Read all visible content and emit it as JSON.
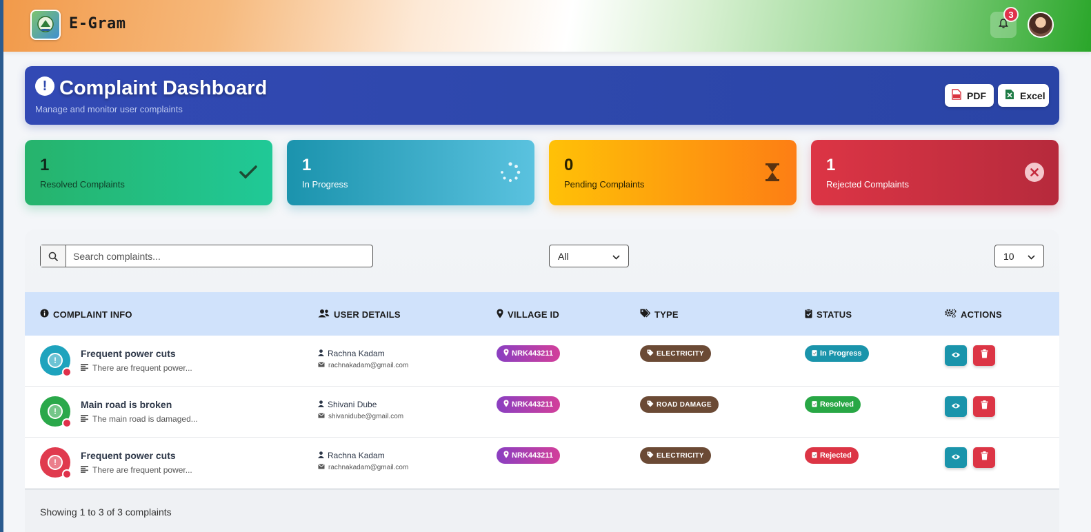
{
  "header": {
    "brand": "E-Gram",
    "notification_count": "3"
  },
  "hero": {
    "title": "Complaint Dashboard",
    "subtitle": "Manage and monitor user complaints",
    "pdf_label": "PDF",
    "excel_label": "Excel"
  },
  "stats": [
    {
      "value": "1",
      "label": "Resolved Complaints",
      "icon": "check-icon"
    },
    {
      "value": "1",
      "label": "In Progress",
      "icon": "spinner-icon"
    },
    {
      "value": "0",
      "label": "Pending Complaints",
      "icon": "hourglass-icon"
    },
    {
      "value": "1",
      "label": "Rejected Complaints",
      "icon": "x-circle-icon"
    }
  ],
  "controls": {
    "search_placeholder": "Search complaints...",
    "filter_value": "All",
    "per_page_value": "10"
  },
  "table": {
    "columns": [
      "COMPLAINT INFO",
      "USER DETAILS",
      "VILLAGE ID",
      "TYPE",
      "STATUS",
      "ACTIONS"
    ],
    "rows": [
      {
        "title": "Frequent power cuts",
        "desc": "There are frequent power...",
        "name": "Rachna Kadam",
        "email": "rachnakadam@gmail.com",
        "village": "NRK443211",
        "type": "ELECTRICITY",
        "status": "In Progress",
        "status_color": "#1a94ab",
        "icon_color": "#1ea3bd"
      },
      {
        "title": "Main road is broken",
        "desc": "The main road is damaged...",
        "name": "Shivani Dube",
        "email": "shivanidube@gmail.com",
        "village": "NRK443211",
        "type": "ROAD DAMAGE",
        "status": "Resolved",
        "status_color": "#28a745",
        "icon_color": "#2aa84a"
      },
      {
        "title": "Frequent power cuts",
        "desc": "There are frequent power...",
        "name": "Rachna Kadam",
        "email": "rachnakadam@gmail.com",
        "village": "NRK443211",
        "type": "ELECTRICITY",
        "status": "Rejected",
        "status_color": "#dc3545",
        "icon_color": "#e03a4e"
      }
    ]
  },
  "footer": {
    "summary": "Showing 1 to 3 of 3 complaints"
  }
}
